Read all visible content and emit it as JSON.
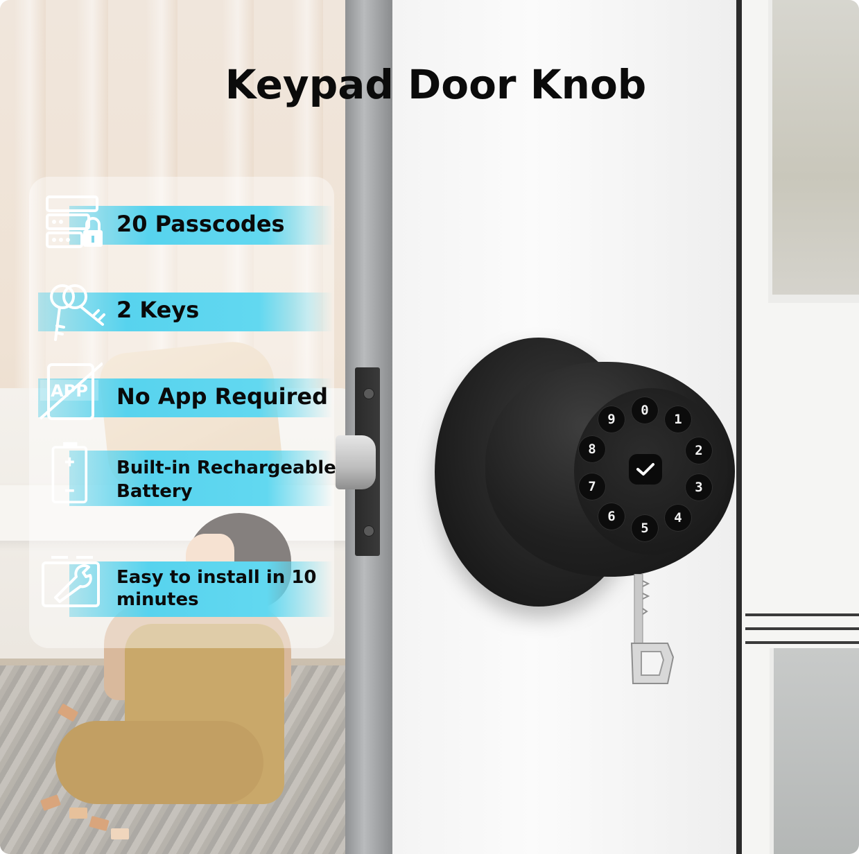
{
  "title": "Keypad Door Knob",
  "features": [
    {
      "label": "20 Passcodes",
      "icon": "server-lock-icon"
    },
    {
      "label": "2 Keys",
      "icon": "keys-icon"
    },
    {
      "label": "No App Required",
      "icon": "no-app-icon",
      "icon_text": "APP"
    },
    {
      "label_line1": "Built-in Rechargeable",
      "label_line2": "Battery",
      "icon": "battery-icon"
    },
    {
      "label_line1": "Easy to install in 10",
      "label_line2": "minutes",
      "icon": "wrench-icon"
    }
  ],
  "keypad": {
    "digits": [
      "0",
      "1",
      "2",
      "3",
      "4",
      "5",
      "6",
      "7",
      "8",
      "9"
    ],
    "confirm_icon": "check-icon"
  },
  "colors": {
    "band": "#57d3ee",
    "knob": "#1c1c1c",
    "title": "#0b0b0b"
  }
}
